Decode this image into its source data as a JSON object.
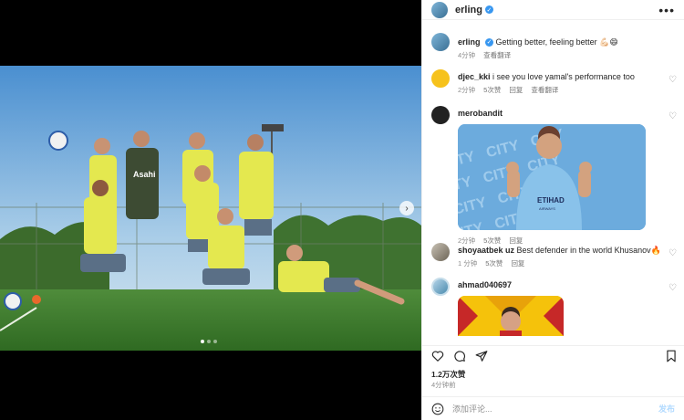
{
  "header": {
    "username": "erling",
    "more_label": "•••"
  },
  "caption": {
    "username": "erling",
    "text": "Getting better, feeling better 💪🏻😄",
    "time": "4分钟",
    "translate": "查看翻译"
  },
  "comments": [
    {
      "username": "djec_kki",
      "text": "i see you love yamal's performance too",
      "time": "2分钟",
      "likes": "5次赞",
      "reply": "回复",
      "translate": "查看翻译"
    },
    {
      "username": "merobandit",
      "text": "",
      "time": "2分钟",
      "likes": "5次赞",
      "reply": "回复",
      "image_text": [
        "CITY",
        "ETIHAD",
        "AIRWAYS"
      ]
    },
    {
      "username": "shoyaatbek uz",
      "text": "Best defender in the world Khusanov🔥",
      "time": "1 分钟",
      "likes": "5次赞",
      "reply": "回复"
    },
    {
      "username": "ahmad040697",
      "text": ""
    }
  ],
  "stats": {
    "likes": "1.2万次赞",
    "time": "4分钟前"
  },
  "comment_bar": {
    "placeholder": "添加评论...",
    "post_label": "发布"
  },
  "photo": {
    "jersey_sponsor": "Asahi"
  },
  "colors": {
    "verified": "#3897f0",
    "city_blue": "#6cabdd",
    "training_yellow": "#e6ec4b",
    "grass": "#3c7a2e"
  }
}
